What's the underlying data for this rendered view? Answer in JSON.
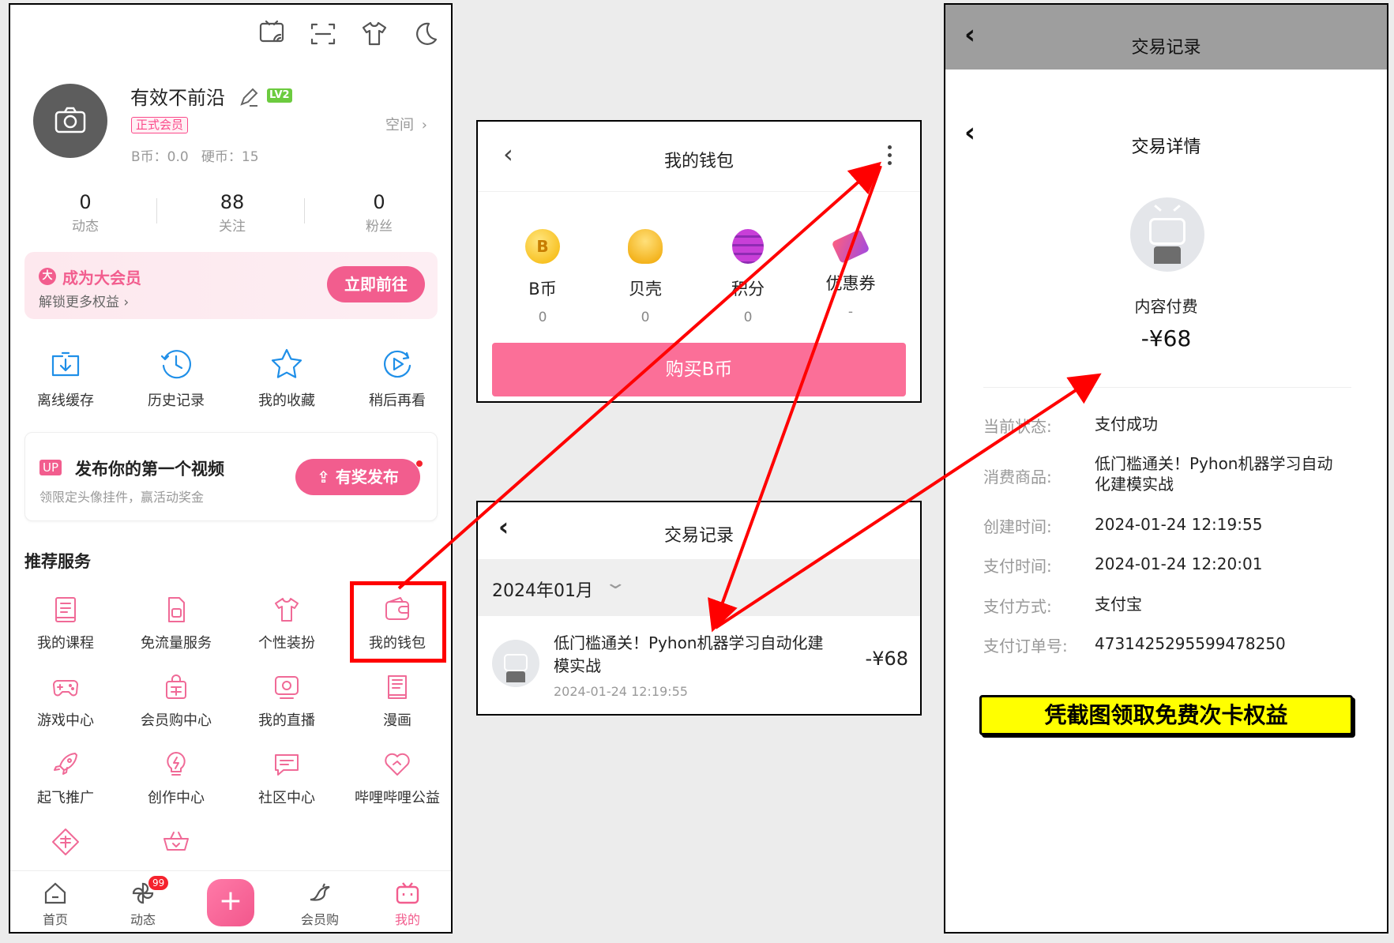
{
  "colors": {
    "brand_pink": "#fb7299",
    "red_annotation": "#ff0000",
    "blue_icon": "#1f8fe8",
    "yellow_banner": "#ffff00"
  },
  "profile": {
    "top_icons": [
      "cast-icon",
      "scan-icon",
      "shirt-icon",
      "moon-icon"
    ],
    "username": "有效不前沿",
    "level_badge": "LV2",
    "member_tag": "正式会员",
    "space_link": "空间",
    "coins": "B币：0.0   硬币：15",
    "stats": [
      {
        "value": "0",
        "label": "动态"
      },
      {
        "value": "88",
        "label": "关注"
      },
      {
        "value": "0",
        "label": "粉丝"
      }
    ],
    "vip_banner": {
      "badge": "大",
      "title": "成为大会员",
      "subtitle": "解锁更多权益",
      "button": "立即前往"
    },
    "quick_items": [
      {
        "label": "离线缓存",
        "icon": "download-icon"
      },
      {
        "label": "历史记录",
        "icon": "history-icon"
      },
      {
        "label": "我的收藏",
        "icon": "star-icon"
      },
      {
        "label": "稍后再看",
        "icon": "watch-later-icon"
      }
    ],
    "upload_card": {
      "tag": "UP",
      "title": "发布你的第一个视频",
      "subtitle": "领限定头像挂件，赢活动奖金",
      "button": "有奖发布"
    },
    "services_title": "推荐服务",
    "services": [
      {
        "label": "我的课程",
        "icon": "course-icon"
      },
      {
        "label": "免流量服务",
        "icon": "sim-icon"
      },
      {
        "label": "个性装扮",
        "icon": "shirt-icon"
      },
      {
        "label": "我的钱包",
        "icon": "wallet-icon"
      },
      {
        "label": "游戏中心",
        "icon": "gamepad-icon"
      },
      {
        "label": "会员购中心",
        "icon": "shop-bag-icon"
      },
      {
        "label": "我的直播",
        "icon": "live-icon"
      },
      {
        "label": "漫画",
        "icon": "comic-icon"
      },
      {
        "label": "起飞推广",
        "icon": "rocket-icon"
      },
      {
        "label": "创作中心",
        "icon": "bulb-icon"
      },
      {
        "label": "社区中心",
        "icon": "chat-icon"
      },
      {
        "label": "哔哩哔哩公益",
        "icon": "heart-icon"
      },
      {
        "label": "",
        "icon": "dragon-icon"
      },
      {
        "label": "",
        "icon": "basket-icon"
      }
    ],
    "bottom_nav": [
      {
        "label": "首页",
        "icon": "home-icon"
      },
      {
        "label": "动态",
        "icon": "pinwheel-icon",
        "badge": "99"
      },
      {
        "label": "",
        "icon": "plus-icon"
      },
      {
        "label": "会员购",
        "icon": "dragon-nav-icon"
      },
      {
        "label": "我的",
        "icon": "tv-icon"
      }
    ]
  },
  "wallet": {
    "title": "我的钱包",
    "items": [
      {
        "label": "B币",
        "value": "0",
        "icon": "bcoin-icon"
      },
      {
        "label": "贝壳",
        "value": "0",
        "icon": "shell-icon"
      },
      {
        "label": "积分",
        "value": "0",
        "icon": "points-icon"
      },
      {
        "label": "优惠券",
        "value": "-",
        "icon": "coupon-icon"
      }
    ],
    "buy_button": "购买B币"
  },
  "transactions": {
    "title": "交易记录",
    "month": "2024年01月",
    "item": {
      "title": "低门槛通关！Pyhon机器学习自动化建模实战",
      "time": "2024-01-24 12:19:55",
      "amount": "-¥68"
    }
  },
  "detail": {
    "outer_title": "交易记录",
    "title": "交易详情",
    "category": "内容付费",
    "amount": "-¥68",
    "rows": [
      {
        "key": "当前状态:",
        "value": "支付成功"
      },
      {
        "key": "消费商品:",
        "value": "低门槛通关！Pyhon机器学习自动化建模实战"
      },
      {
        "key": "创建时间:",
        "value": "2024-01-24 12:19:55"
      },
      {
        "key": "支付时间:",
        "value": "2024-01-24 12:20:01"
      },
      {
        "key": "支付方式:",
        "value": "支付宝"
      },
      {
        "key": "支付订单号:",
        "value": "4731425295599478250"
      }
    ],
    "banner": "凭截图领取免费次卡权益"
  }
}
